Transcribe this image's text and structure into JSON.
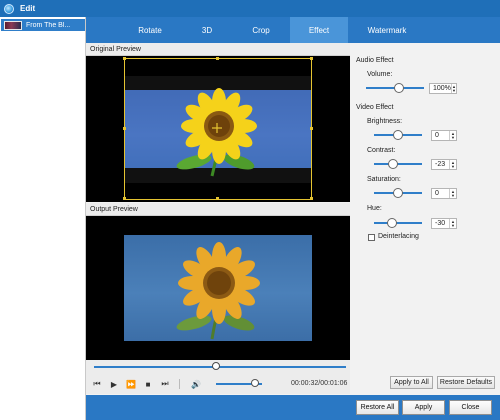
{
  "window": {
    "title": "Edit"
  },
  "filelist": {
    "items": [
      {
        "name": "From The Bl..."
      }
    ]
  },
  "tabs": [
    {
      "label": "Rotate"
    },
    {
      "label": "3D"
    },
    {
      "label": "Crop"
    },
    {
      "label": "Effect",
      "active": true
    },
    {
      "label": "Watermark"
    }
  ],
  "preview": {
    "original_label": "Original Preview",
    "output_label": "Output Preview"
  },
  "player": {
    "timecode": "00:00:32/00:01:06",
    "progress": 0.485,
    "volume": 0.85
  },
  "audio": {
    "section_title": "Audio Effect",
    "volume_label": "Volume:",
    "volume_value": "100%"
  },
  "video": {
    "section_title": "Video Effect",
    "brightness_label": "Brightness:",
    "brightness_value": "0",
    "contrast_label": "Contrast:",
    "contrast_value": "-23",
    "saturation_label": "Saturation:",
    "saturation_value": "0",
    "hue_label": "Hue:",
    "hue_value": "-30",
    "deinterlacing_label": "Deinterlacing"
  },
  "buttons": {
    "apply_to_all": "Apply to All",
    "restore_defaults": "Restore Defaults",
    "restore_all": "Restore All",
    "apply": "Apply",
    "close": "Close"
  },
  "colors": {
    "accent_blue": "#2a78c4",
    "crop_frame": "#e5c431"
  }
}
